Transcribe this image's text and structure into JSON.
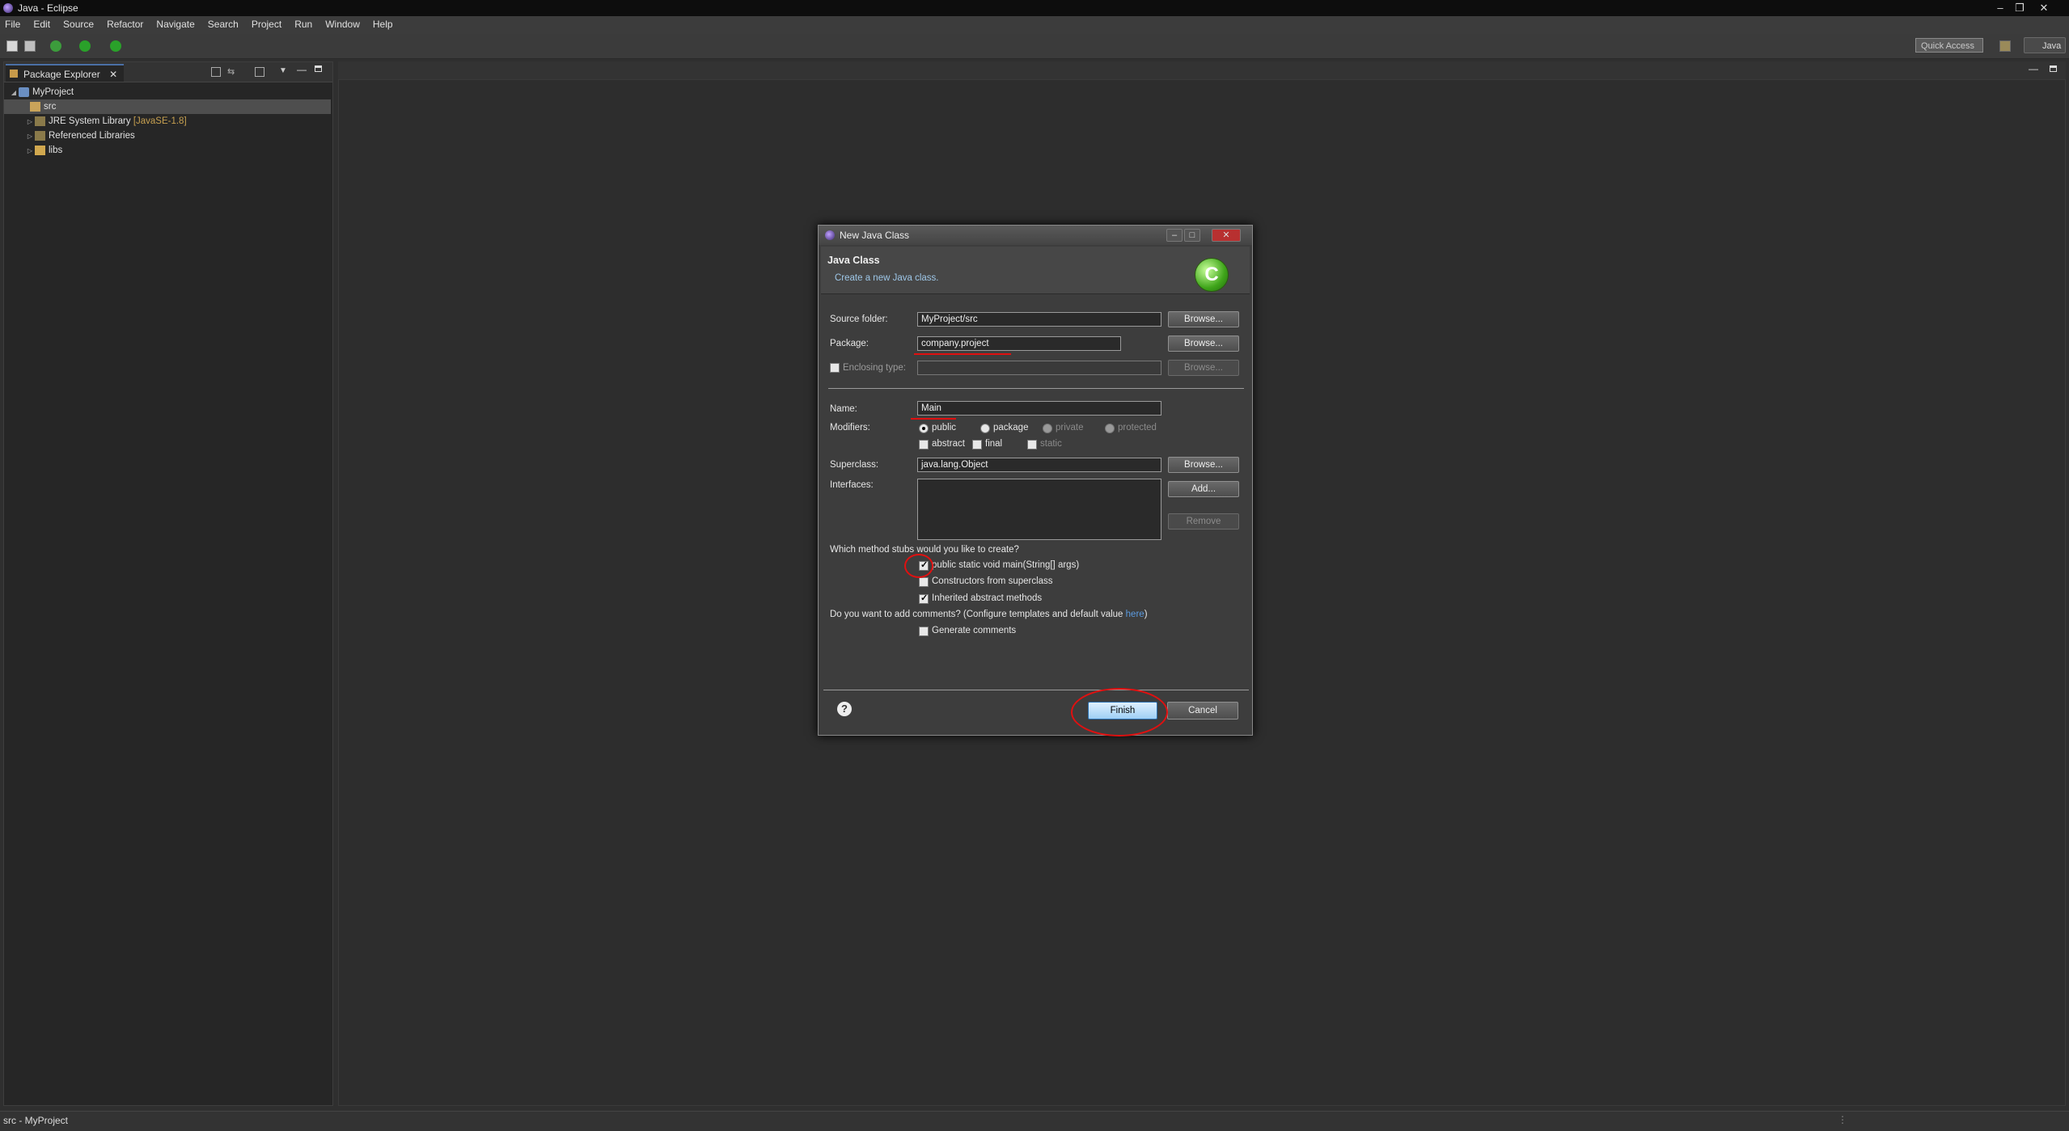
{
  "window": {
    "title": "Java - Eclipse"
  },
  "menu": [
    "File",
    "Edit",
    "Source",
    "Refactor",
    "Navigate",
    "Search",
    "Project",
    "Run",
    "Window",
    "Help"
  ],
  "toolbar": {
    "quick_access": "Quick Access",
    "perspective": "Java"
  },
  "package_explorer": {
    "tab_label": "Package Explorer",
    "tree": [
      {
        "label": "MyProject",
        "decoration": ""
      },
      {
        "label": "src",
        "decoration": ""
      },
      {
        "label": "JRE System Library",
        "decoration": "[JavaSE-1.8]"
      },
      {
        "label": "Referenced Libraries",
        "decoration": ""
      },
      {
        "label": "libs",
        "decoration": ""
      }
    ]
  },
  "status_bar": {
    "text": "src - MyProject"
  },
  "dialog": {
    "title": "New Java Class",
    "header_title": "Java Class",
    "header_desc": "Create a new Java class.",
    "source_folder": {
      "label": "Source folder:",
      "value": "MyProject/src",
      "browse": "Browse..."
    },
    "package": {
      "label": "Package:",
      "value": "company.project",
      "browse": "Browse..."
    },
    "enclosing": {
      "label": "Enclosing type:",
      "value": "",
      "browse": "Browse..."
    },
    "name": {
      "label": "Name:",
      "value": "Main"
    },
    "modifiers": {
      "label": "Modifiers:",
      "public": "public",
      "package": "package",
      "private": "private",
      "protected": "protected",
      "abstract": "abstract",
      "final": "final",
      "static": "static"
    },
    "superclass": {
      "label": "Superclass:",
      "value": "java.lang.Object",
      "browse": "Browse..."
    },
    "interfaces": {
      "label": "Interfaces:",
      "add": "Add...",
      "remove": "Remove"
    },
    "stubs": {
      "question": "Which method stubs would you like to create?",
      "main": "public static void main(String[] args)",
      "constructors": "Constructors from superclass",
      "inherited": "Inherited abstract methods"
    },
    "comments": {
      "question_pre": "Do you want to add comments? (Configure templates and default value ",
      "question_link": "here",
      "question_post": ")",
      "generate": "Generate comments"
    },
    "help": "?",
    "finish": "Finish",
    "cancel": "Cancel"
  },
  "colors": {
    "annotation": "#e01010",
    "accent_link": "#5b9be0"
  }
}
